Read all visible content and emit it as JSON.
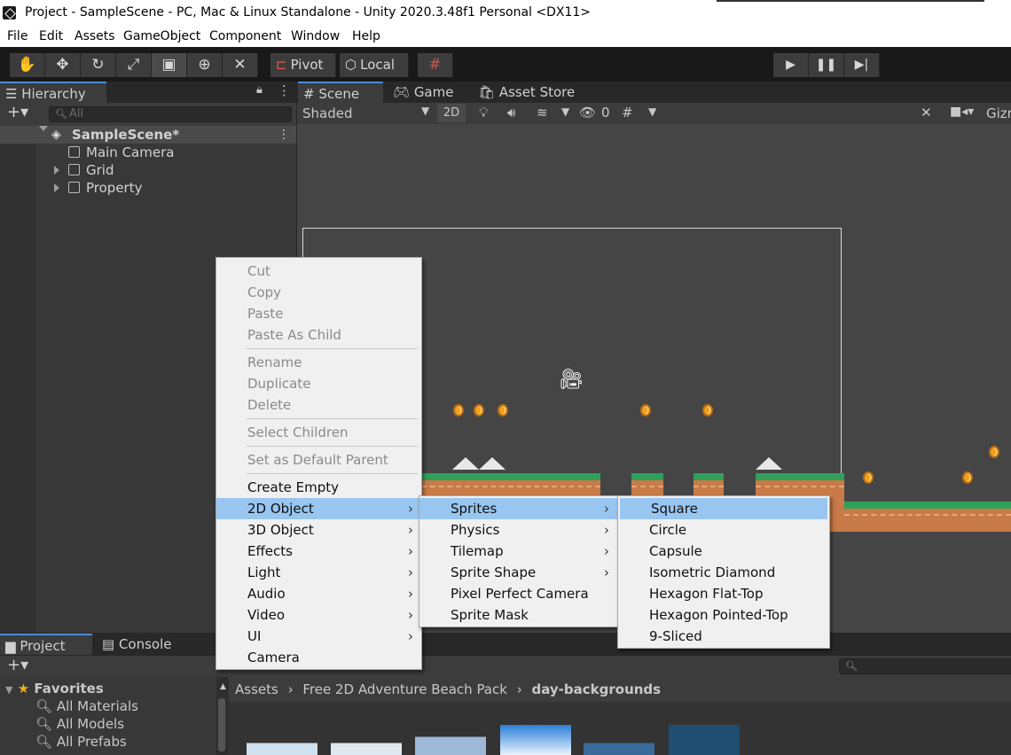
{
  "window": {
    "title": "Project - SampleScene - PC, Mac & Linux Standalone - Unity 2020.3.48f1 Personal <DX11>"
  },
  "menubar": [
    "File",
    "Edit",
    "Assets",
    "GameObject",
    "Component",
    "Window",
    "Help"
  ],
  "toolbar": {
    "pivot_label": "Pivot",
    "local_label": "Local"
  },
  "hierarchy": {
    "tab_label": "Hierarchy",
    "search_placeholder": "All",
    "scene_name": "SampleScene*",
    "items": [
      "Main Camera",
      "Grid",
      "Property"
    ]
  },
  "scene": {
    "tabs": [
      "Scene",
      "Game",
      "Asset Store"
    ],
    "shading_mode": "Shaded",
    "mode_2d": "2D",
    "hidden_count": "0",
    "gizmos_label": "Gizr"
  },
  "project": {
    "tabs": [
      "Project",
      "Console"
    ],
    "favorites_label": "Favorites",
    "favorites": [
      "All Materials",
      "All Models",
      "All Prefabs"
    ],
    "breadcrumb": [
      "Assets",
      "Free 2D Adventure Beach Pack",
      "day-backgrounds"
    ]
  },
  "context_menu": {
    "group1": [
      "Cut",
      "Copy",
      "Paste",
      "Paste As Child"
    ],
    "group2": [
      "Rename",
      "Duplicate",
      "Delete"
    ],
    "group3": [
      "Select Children"
    ],
    "group4": [
      "Set as Default Parent"
    ],
    "group5": [
      "Create Empty",
      "2D Object",
      "3D Object",
      "Effects",
      "Light",
      "Audio",
      "Video",
      "UI",
      "Camera"
    ]
  },
  "submenu_2d": [
    "Sprites",
    "Physics",
    "Tilemap",
    "Sprite Shape",
    "Pixel Perfect Camera",
    "Sprite Mask"
  ],
  "submenu_sprites": [
    "Square",
    "Circle",
    "Capsule",
    "Isometric Diamond",
    "Hexagon Flat-Top",
    "Hexagon Pointed-Top",
    "9-Sliced"
  ],
  "colors": {
    "highlight": "#98c6f0",
    "accent": "#4d8bd6"
  }
}
